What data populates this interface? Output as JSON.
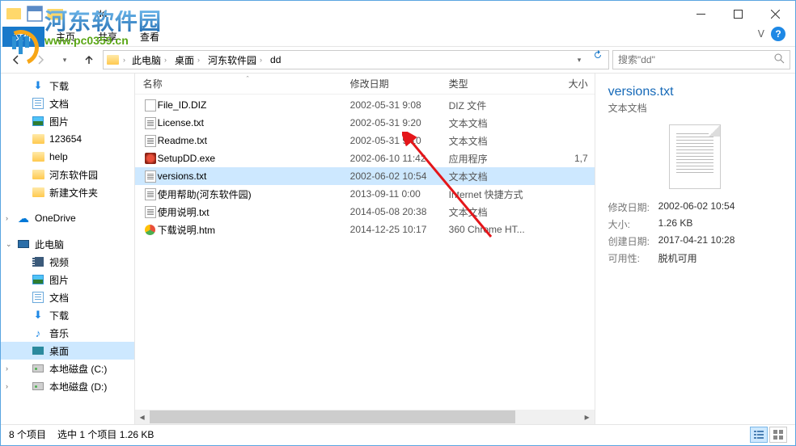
{
  "window": {
    "title": "dd"
  },
  "ribbon": {
    "file": "文件",
    "tabs": [
      "主页",
      "共享",
      "查看"
    ]
  },
  "breadcrumb": {
    "items": [
      "此电脑",
      "桌面",
      "河东软件园",
      "dd"
    ]
  },
  "search": {
    "placeholder": "搜索\"dd\""
  },
  "sidebar": {
    "items": [
      {
        "label": "下载",
        "icon": "download",
        "level": 2
      },
      {
        "label": "文档",
        "icon": "docs",
        "level": 2
      },
      {
        "label": "图片",
        "icon": "pic",
        "level": 2
      },
      {
        "label": "123654",
        "icon": "folder",
        "level": 2
      },
      {
        "label": "help",
        "icon": "folder",
        "level": 2
      },
      {
        "label": "河东软件园",
        "icon": "folder",
        "level": 2
      },
      {
        "label": "新建文件夹",
        "icon": "folder",
        "level": 2
      },
      {
        "spacer": true
      },
      {
        "label": "OneDrive",
        "icon": "cloud",
        "level": 1,
        "expand": ">"
      },
      {
        "spacer": true
      },
      {
        "label": "此电脑",
        "icon": "pc",
        "level": 1,
        "expand": "v"
      },
      {
        "label": "视频",
        "icon": "video",
        "level": 2
      },
      {
        "label": "图片",
        "icon": "pic",
        "level": 2
      },
      {
        "label": "文档",
        "icon": "docs",
        "level": 2
      },
      {
        "label": "下载",
        "icon": "download",
        "level": 2
      },
      {
        "label": "音乐",
        "icon": "music",
        "level": 2
      },
      {
        "label": "桌面",
        "icon": "desktop",
        "level": 2,
        "selected": true
      },
      {
        "label": "本地磁盘 (C:)",
        "icon": "drive",
        "level": 2,
        "expand": ">"
      },
      {
        "label": "本地磁盘 (D:)",
        "icon": "drive",
        "level": 2,
        "expand": ">"
      }
    ]
  },
  "columns": {
    "name": "名称",
    "date": "修改日期",
    "type": "类型",
    "size": "大小"
  },
  "files": [
    {
      "name": "File_ID.DIZ",
      "date": "2002-05-31 9:08",
      "type": "DIZ 文件",
      "icon": "diz"
    },
    {
      "name": "License.txt",
      "date": "2002-05-31 9:20",
      "type": "文本文档",
      "icon": "txt"
    },
    {
      "name": "Readme.txt",
      "date": "2002-05-31 9:10",
      "type": "文本文档",
      "icon": "txt"
    },
    {
      "name": "SetupDD.exe",
      "date": "2002-06-10 11:42",
      "type": "应用程序",
      "size": "1,7",
      "icon": "exe"
    },
    {
      "name": "versions.txt",
      "date": "2002-06-02 10:54",
      "type": "文本文档",
      "icon": "txt",
      "selected": true
    },
    {
      "name": "使用帮助(河东软件园)",
      "date": "2013-09-11 0:00",
      "type": "Internet 快捷方式",
      "icon": "txt"
    },
    {
      "name": "使用说明.txt",
      "date": "2014-05-08 20:38",
      "type": "文本文档",
      "icon": "txt"
    },
    {
      "name": "下载说明.htm",
      "date": "2014-12-25 10:17",
      "type": "360 Chrome HT...",
      "icon": "htm"
    }
  ],
  "details": {
    "title": "versions.txt",
    "subtitle": "文本文档",
    "rows": [
      {
        "label": "修改日期:",
        "value": "2002-06-02 10:54"
      },
      {
        "label": "大小:",
        "value": "1.26 KB"
      },
      {
        "label": "创建日期:",
        "value": "2017-04-21 10:28"
      },
      {
        "label": "可用性:",
        "value": "脱机可用"
      }
    ]
  },
  "status": {
    "count": "8 个项目",
    "selected": "选中 1 个项目 1.26 KB"
  },
  "watermark": {
    "main": "河东软件园",
    "url": "www.pc0359.cn"
  }
}
